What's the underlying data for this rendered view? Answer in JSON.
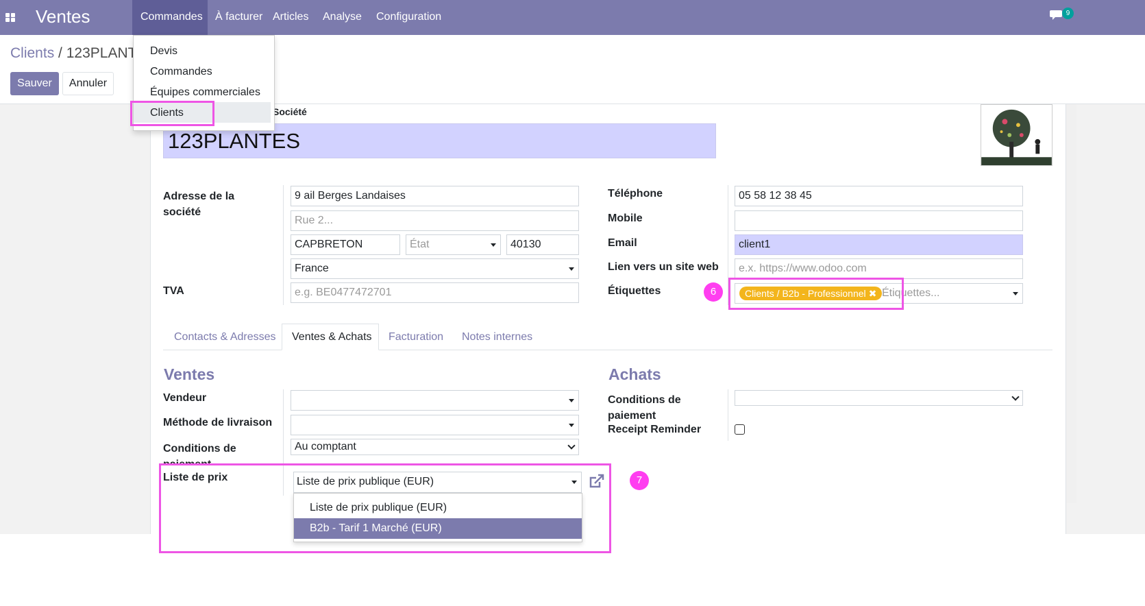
{
  "navbar": {
    "app_title": "Ventes",
    "menu": [
      "Commandes",
      "À facturer",
      "Articles",
      "Analyse",
      "Configuration"
    ],
    "notification_count": "9",
    "icons": {
      "apps": "apps-grid-icon",
      "chat": "chat-icon"
    }
  },
  "nav_dropdown": {
    "items": [
      "Devis",
      "Commandes",
      "Équipes commerciales",
      "Clients"
    ]
  },
  "breadcrumb": {
    "parent": "Clients",
    "separator": " / ",
    "current": "123PLANTES"
  },
  "buttons": {
    "save": "Sauver",
    "cancel": "Annuler"
  },
  "form": {
    "company_type_label": "Société",
    "name": "123PLANTES",
    "address_label": "Adresse de la société",
    "street": "9 ail Berges Landaises",
    "street2_placeholder": "Rue 2...",
    "city": "CAPBRETON",
    "state_placeholder": "État",
    "zip": "40130",
    "country": "France",
    "vat_label": "TVA",
    "vat_placeholder": "e.g. BE0477472701",
    "phone_label": "Téléphone",
    "phone": "05 58 12 38 45",
    "mobile_label": "Mobile",
    "email_label": "Email",
    "email": "client1",
    "website_label": "Lien vers un site web",
    "website_placeholder": "e.x. https://www.odoo.com",
    "tags_label": "Étiquettes",
    "tag": "Clients / B2b - Professionnel",
    "tag_remove": "✖",
    "tags_placeholder": "Étiquettes..."
  },
  "annotations": {
    "step6": "6",
    "step7": "7",
    "highlight_color": "#ee55e5"
  },
  "tabs": [
    "Contacts & Adresses",
    "Ventes & Achats",
    "Facturation",
    "Notes internes"
  ],
  "sales": {
    "title": "Ventes",
    "salesperson_label": "Vendeur",
    "delivery_label": "Méthode de livraison",
    "payment_terms_label": "Conditions de paiement",
    "payment_terms": "Au comptant",
    "pricelist_label": "Liste de prix",
    "pricelist": "Liste de prix publique (EUR)"
  },
  "purchases": {
    "title": "Achats",
    "payment_terms_label": "Conditions de paiement",
    "receipt_reminder_label": "Receipt Reminder",
    "receipt_reminder_checked": false
  },
  "pricelist_options": [
    "Liste de prix publique (EUR)",
    "B2b - Tarif 1 Marché (EUR)"
  ],
  "colors": {
    "brand": "#7c7bad",
    "brand_dark": "#5f5e97",
    "tag": "#f3b51c",
    "badge": "#00a09d",
    "highlight_field": "#d2d2ff"
  }
}
